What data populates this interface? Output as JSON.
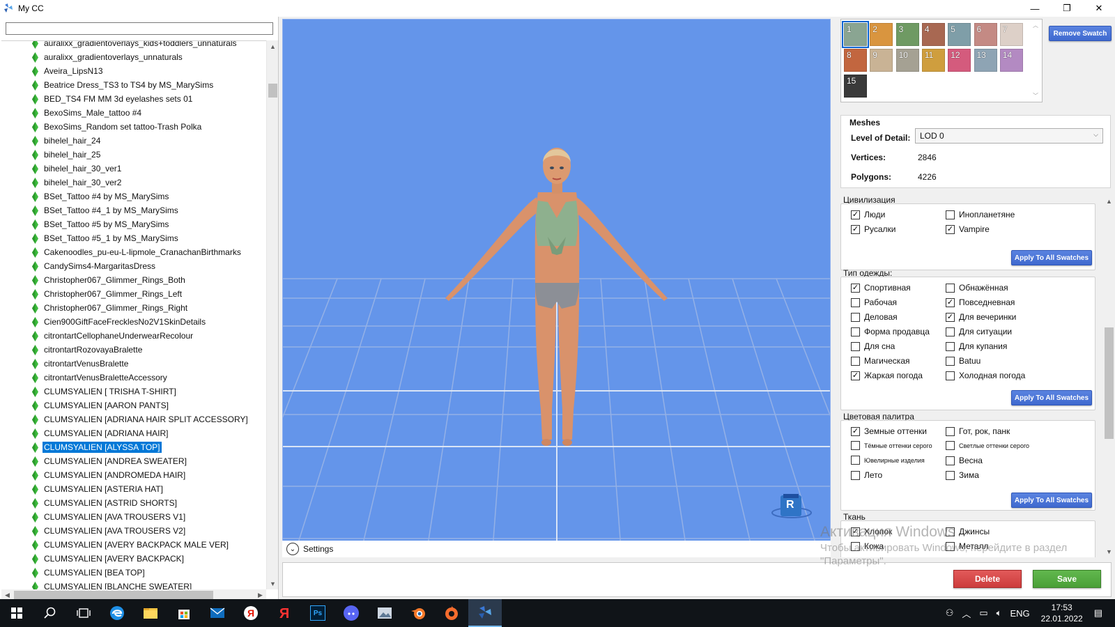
{
  "window": {
    "title": "My CC",
    "controls": [
      "—",
      "❐",
      "✕"
    ]
  },
  "left_panel": {
    "search_value": "",
    "items": [
      "auralixx_gradientoverlays_kids+toddlers_unnaturals",
      "auralixx_gradientoverlays_unnaturals",
      "Aveira_LipsN13",
      "Beatrice Dress_TS3 to TS4 by MS_MarySims",
      "BED_TS4 FM MM 3d eyelashes sets 01",
      "BexoSims_Male_tattoo #4",
      "BexoSims_Random set tattoo-Trash Polka",
      "bihelel_hair_24",
      "bihelel_hair_25",
      "bihelel_hair_30_ver1",
      "bihelel_hair_30_ver2",
      "BSet_Tattoo #4  by MS_MarySims",
      "BSet_Tattoo #4_1  by MS_MarySims",
      "BSet_Tattoo #5  by MS_MarySims",
      "BSet_Tattoo #5_1  by MS_MarySims",
      "Cakenoodles_pu-eu-L-lipmole_CranachanBirthmarks",
      "CandySims4-MargaritasDress",
      "Christopher067_Glimmer_Rings_Both",
      "Christopher067_Glimmer_Rings_Left",
      "Christopher067_Glimmer_Rings_Right",
      "Cien900GiftFaceFrecklesNo2V1SkinDetails",
      "citrontartCellophaneUnderwearRecolour",
      "citrontartRozovayaBralette",
      "citrontartVenusBralette",
      "citrontartVenusBraletteAccessory",
      "CLUMSYALIEN [ TRISHA T-SHIRT]",
      "CLUMSYALIEN [AARON PANTS]",
      "CLUMSYALIEN [ADRIANA HAIR SPLIT ACCESSORY]",
      "CLUMSYALIEN [ADRIANA HAIR]",
      "CLUMSYALIEN [ALYSSA TOP]",
      "CLUMSYALIEN [ANDREA SWEATER]",
      "CLUMSYALIEN [ANDROMEDA HAIR]",
      "CLUMSYALIEN [ASTERIA HAT]",
      "CLUMSYALIEN [ASTRID SHORTS]",
      "CLUMSYALIEN [AVA TROUSERS V1]",
      "CLUMSYALIEN [AVA TROUSERS V2]",
      "CLUMSYALIEN [AVERY BACKPACK MALE VER]",
      "CLUMSYALIEN [AVERY BACKPACK]",
      "CLUMSYALIEN [BEA TOP]",
      "CLUMSYALIEN [BLANCHE SWEATER]"
    ],
    "selected_index": 29
  },
  "viewport": {
    "background": "#6495ea",
    "settings_label": "Settings",
    "gizmo_label": "R"
  },
  "swatches": {
    "selected": 0,
    "items": [
      {
        "label": "1",
        "color": "#8aa592"
      },
      {
        "label": "2",
        "color": "#d9953f"
      },
      {
        "label": "3",
        "color": "#6f9a63"
      },
      {
        "label": "4",
        "color": "#a86852"
      },
      {
        "label": "5",
        "color": "#7f9ea8"
      },
      {
        "label": "6",
        "color": "#c48a84"
      },
      {
        "label": "7",
        "color": "#ddd0c8"
      },
      {
        "label": "8",
        "color": "#c2663f"
      },
      {
        "label": "9",
        "color": "#c9b395"
      },
      {
        "label": "10",
        "color": "#a5a193"
      },
      {
        "label": "11",
        "color": "#cf9e3e"
      },
      {
        "label": "12",
        "color": "#d45b7d"
      },
      {
        "label": "13",
        "color": "#8ea4b4"
      },
      {
        "label": "14",
        "color": "#b38ac2"
      },
      {
        "label": "15",
        "color": "#3a3a3a"
      }
    ],
    "remove_label": "Remove Swatch"
  },
  "meshes": {
    "header": "Meshes",
    "lod_label": "Level of Detail:",
    "lod_value": "LOD 0",
    "vertices_label": "Vertices:",
    "vertices_value": "2846",
    "polygons_label": "Polygons:",
    "polygons_value": "4226"
  },
  "apply_label": "Apply To All Swatches",
  "groups": {
    "civ": {
      "title": "Цивилизация",
      "items": [
        {
          "label": "Люди",
          "checked": true
        },
        {
          "label": "Инопланетяне",
          "checked": false
        },
        {
          "label": "Русалки",
          "checked": true
        },
        {
          "label": "Vampire",
          "checked": true
        }
      ]
    },
    "clothing": {
      "title": "Тип одежды:",
      "items": [
        {
          "label": "Спортивная",
          "checked": true
        },
        {
          "label": "Обнажённая",
          "checked": false
        },
        {
          "label": "Рабочая",
          "checked": false
        },
        {
          "label": "Повседневная",
          "checked": true
        },
        {
          "label": "Деловая",
          "checked": false
        },
        {
          "label": "Для вечеринки",
          "checked": true
        },
        {
          "label": "Форма продавца",
          "checked": false
        },
        {
          "label": "Для ситуации",
          "checked": false
        },
        {
          "label": "Для сна",
          "checked": false
        },
        {
          "label": "Для купания",
          "checked": false
        },
        {
          "label": "Магическая",
          "checked": false
        },
        {
          "label": "Batuu",
          "checked": false
        },
        {
          "label": "Жаркая погода",
          "checked": true
        },
        {
          "label": "Холодная погода",
          "checked": false
        }
      ]
    },
    "palette": {
      "title": "Цветовая палитра",
      "items": [
        {
          "label": "Земные оттенки",
          "checked": true
        },
        {
          "label": "Гот, рок, панк",
          "checked": false
        },
        {
          "label": "Тёмные оттенки серого",
          "checked": false,
          "small": true
        },
        {
          "label": "Светлые оттенки серого",
          "checked": false,
          "small": true
        },
        {
          "label": "Ювелирные изделия",
          "checked": false,
          "small": true
        },
        {
          "label": "Весна",
          "checked": false
        },
        {
          "label": "Лето",
          "checked": false
        },
        {
          "label": "Зима",
          "checked": false
        }
      ]
    },
    "fabric": {
      "title": "Ткань",
      "items": [
        {
          "label": "Хлопок",
          "checked": true
        },
        {
          "label": "Джинсы",
          "checked": false
        },
        {
          "label": "Кожа",
          "checked": false
        },
        {
          "label": "Металл",
          "checked": false
        }
      ]
    }
  },
  "watermark": {
    "line1": "Активация Windows",
    "line2": "Чтобы активировать Windows, перейдите в раздел",
    "line3": "\"Параметры\"."
  },
  "actions": {
    "delete": "Delete",
    "save": "Save"
  },
  "taskbar": {
    "icons": [
      "windows-start-icon",
      "search-icon",
      "task-view-icon",
      "edge-icon",
      "file-explorer-icon",
      "store-icon",
      "mail-icon",
      "yandex-browser-icon",
      "yandex-icon",
      "photoshop-icon",
      "discord-icon",
      "image-viewer-icon",
      "blender-icon",
      "origin-icon",
      "sims4-studio-icon"
    ],
    "photoshop_label": "Ps",
    "lang": "ENG",
    "time": "17:53",
    "date": "22.01.2022"
  }
}
